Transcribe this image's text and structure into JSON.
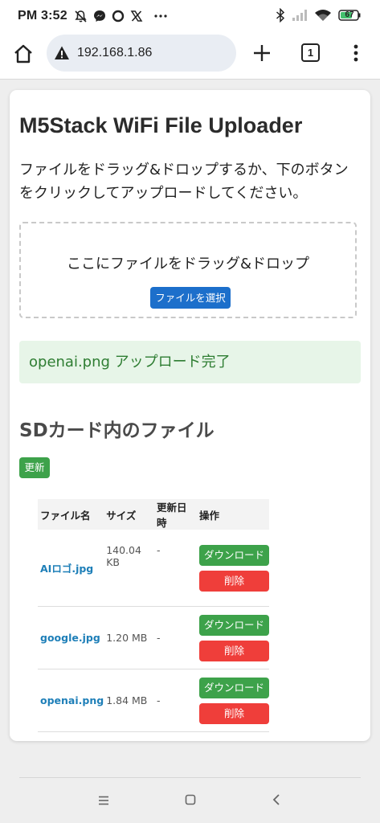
{
  "status_bar": {
    "time": "PM 3:52",
    "battery": "67",
    "icons": [
      "muted-icon",
      "messenger-icon",
      "circle-app-icon",
      "x-app-icon",
      "more-dots-icon",
      "bluetooth-icon",
      "signal-icon",
      "wifi-icon",
      "battery-icon"
    ]
  },
  "browser": {
    "url": "192.168.1.86",
    "tab_count": "1",
    "icons": [
      "home-icon",
      "warning-icon",
      "plus-icon",
      "tabs-icon",
      "menu-icon"
    ]
  },
  "page": {
    "title": "M5Stack WiFi File Uploader",
    "instructions": "ファイルをドラッグ&ドロップするか、下のボタンをクリックしてアップロードしてください。",
    "dropzone_text": "ここにファイルをドラッグ&ドロップ",
    "choose_button": "ファイルを選択",
    "success_message": "openai.png アップロード完了",
    "section_title": "SDカード内のファイル",
    "refresh_button": "更新",
    "table": {
      "columns": [
        "ファイル名",
        "サイズ",
        "更新日時",
        "操作"
      ],
      "rows": [
        {
          "name": "AIロゴ.jpg",
          "size": "140.04 KB",
          "modified": "-",
          "download": "ダウンロード",
          "delete": "削除"
        },
        {
          "name": "google.jpg",
          "size": "1.20 MB",
          "modified": "-",
          "download": "ダウンロード",
          "delete": "削除"
        },
        {
          "name": "openai.png",
          "size": "1.84 MB",
          "modified": "-",
          "download": "ダウンロード",
          "delete": "削除"
        }
      ]
    }
  },
  "colors": {
    "primary_blue": "#1c6fcb",
    "green": "#3da24a",
    "red": "#ef3e3a",
    "success_text": "#2e7d32",
    "link": "#1e7fb8"
  },
  "nav_bar": {
    "icons": [
      "recents-menu-icon",
      "home-square-icon",
      "back-chevron-icon"
    ]
  }
}
